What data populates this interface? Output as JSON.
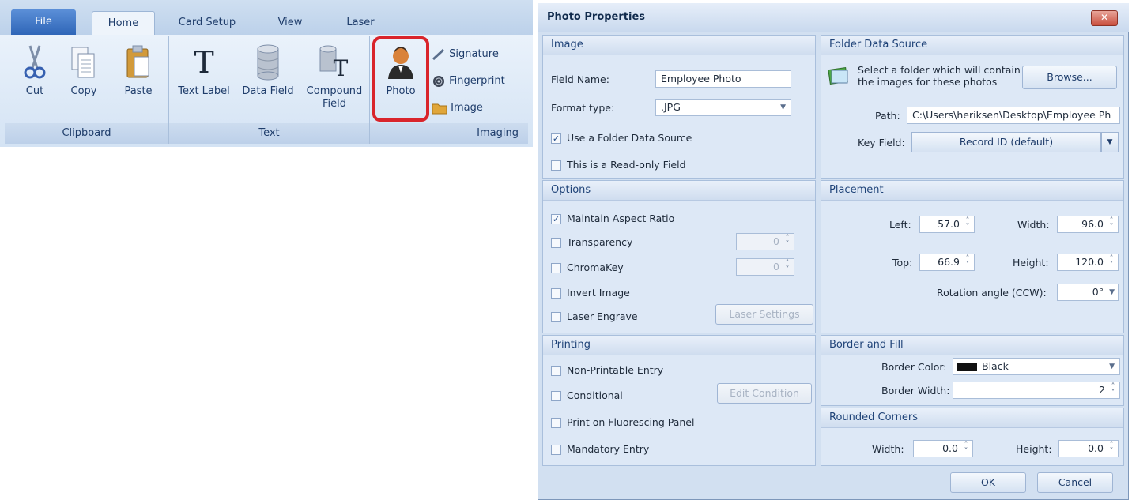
{
  "ribbon": {
    "tabs": [
      "File",
      "Home",
      "Card Setup",
      "View",
      "Laser"
    ],
    "clipboard": {
      "label": "Clipboard",
      "cut": "Cut",
      "copy": "Copy",
      "paste": "Paste"
    },
    "text": {
      "label": "Text",
      "text_label": "Text Label",
      "data_field": "Data Field",
      "compound_line1": "Compound",
      "compound_line2": "Field"
    },
    "imaging": {
      "label": "Imaging",
      "photo": "Photo",
      "signature": "Signature",
      "fingerprint": "Fingerprint",
      "image": "Image"
    }
  },
  "dialog": {
    "title": "Photo Properties",
    "close_glyph": "✕",
    "image": {
      "header": "Image",
      "field_name_label": "Field Name:",
      "field_name_value": "Employee Photo",
      "format_label": "Format type:",
      "format_value": ".JPG",
      "use_folder": "Use a Folder Data Source",
      "read_only": "This is a Read-only Field"
    },
    "folder": {
      "header": "Folder Data Source",
      "desc_line1": "Select a folder which will contain",
      "desc_line2": "the images for these photos",
      "browse": "Browse...",
      "path_label": "Path:",
      "path_value": "C:\\Users\\heriksen\\Desktop\\Employee Ph",
      "key_label": "Key Field:",
      "key_value": "Record ID (default)"
    },
    "options": {
      "header": "Options",
      "maintain": "Maintain Aspect Ratio",
      "transparency": "Transparency",
      "transparency_value": "0",
      "chromakey": "ChromaKey",
      "chromakey_value": "0",
      "invert": "Invert Image",
      "laser": "Laser Engrave",
      "laser_settings": "Laser Settings"
    },
    "placement": {
      "header": "Placement",
      "left_label": "Left:",
      "left_value": "57.0",
      "width_label": "Width:",
      "width_value": "96.0",
      "top_label": "Top:",
      "top_value": "66.9",
      "height_label": "Height:",
      "height_value": "120.0",
      "rotation_label": "Rotation angle (CCW):",
      "rotation_value": "0°"
    },
    "printing": {
      "header": "Printing",
      "non_printable": "Non-Printable Entry",
      "conditional": "Conditional",
      "edit_condition": "Edit Condition",
      "fluorescing": "Print on Fluorescing Panel",
      "mandatory": "Mandatory Entry"
    },
    "border": {
      "header": "Border and Fill",
      "color_label": "Border Color:",
      "color_value": "Black",
      "width_label": "Border Width:",
      "width_value": "2"
    },
    "rounded": {
      "header": "Rounded Corners",
      "width_label": "Width:",
      "width_value": "0.0",
      "height_label": "Height:",
      "height_value": "0.0"
    },
    "ok": "OK",
    "cancel": "Cancel"
  }
}
